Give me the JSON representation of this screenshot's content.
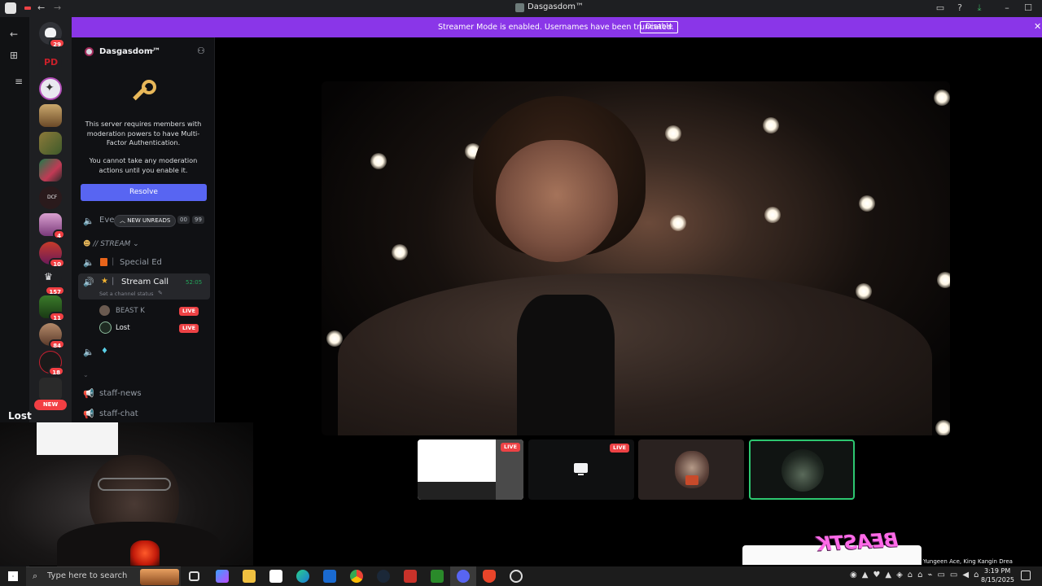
{
  "window": {
    "title": "Dasgasdom™"
  },
  "banner": {
    "message": "Streamer Mode is enabled. Usernames have been truncated.",
    "button": "Disable"
  },
  "rail": {
    "badges": [
      "29",
      "4",
      "10",
      "157",
      "11",
      "84",
      "18"
    ],
    "new_label": "NEW",
    "mini_text_1": "PD",
    "mini_text_2": "DCF"
  },
  "sidebar": {
    "server_name": "Dasgasdom™",
    "mfa_line1": "This server requires members with moderation powers to have Multi-Factor Authentication.",
    "mfa_line2": "You cannot take any moderation actions until you enable it.",
    "resolve_button": "Resolve",
    "partial_channel": "Eve",
    "new_unreads": "NEW UNREADS",
    "counter_a": "00",
    "counter_b": "99",
    "category": "// STREAM",
    "channels": [
      {
        "name": "Special Ed"
      },
      {
        "name": "Stream Call",
        "timer": "52:05",
        "status": "Set a channel status"
      }
    ],
    "members": [
      {
        "name": "BEAST K",
        "live": "LIVE"
      },
      {
        "name": "Lost",
        "live": "LIVE"
      }
    ],
    "text_channels": [
      "staff-news",
      "staff-chat"
    ]
  },
  "thumbs": {
    "live1": "LIVE",
    "live2": "LIVE"
  },
  "webcam": {
    "overlay_label": "Lost"
  },
  "overlay": {
    "sticker": "BEASTK",
    "song": "Yungeen Ace, King Kangin Drea"
  },
  "taskbar": {
    "search_placeholder": "Type here to search",
    "time": "3:19 PM",
    "date": "8/15/2025"
  },
  "colors": {
    "banner": "#8a36e8",
    "resolve": "#5865f2",
    "live": "#ed4245",
    "timer": "#23a55a",
    "selected_tile_border": "#2dc770"
  }
}
